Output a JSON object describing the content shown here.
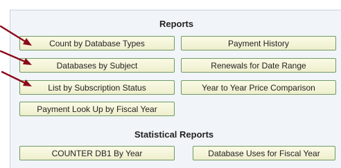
{
  "reports": {
    "title": "Reports",
    "buttons": [
      "Count by Database Types",
      "Payment History",
      "Databases by Subject",
      "Renewals for Date Range",
      "List by Subscription Status",
      "Year to Year Price Comparison",
      "Payment Look Up by Fiscal Year"
    ]
  },
  "statistical_reports": {
    "title": "Statistical Reports",
    "buttons": [
      "COUNTER DB1 By Year",
      "Database Uses for Fiscal Year"
    ]
  },
  "colors": {
    "arrow": "#8b0a1a",
    "button_border": "#6e9a63",
    "button_fill": "#f6f6dc",
    "panel_background": "#f1f4f8"
  },
  "icons": [
    "arrow-pointer-icon"
  ]
}
